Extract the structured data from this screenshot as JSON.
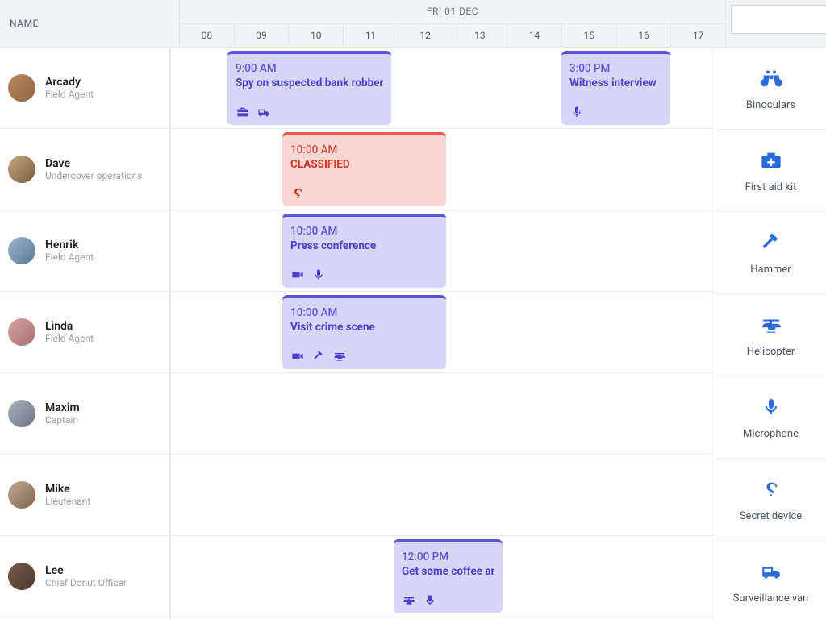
{
  "columns": {
    "name_header": "NAME"
  },
  "date_label": "FRI 01 DEC",
  "hours": [
    "08",
    "09",
    "10",
    "11",
    "12",
    "13",
    "14",
    "15",
    "16",
    "17"
  ],
  "search": {
    "placeholder": ""
  },
  "resources": [
    {
      "name": "Arcady",
      "title": "Field Agent"
    },
    {
      "name": "Dave",
      "title": "Undercover operations"
    },
    {
      "name": "Henrik",
      "title": "Field Agent"
    },
    {
      "name": "Linda",
      "title": "Field Agent"
    },
    {
      "name": "Maxim",
      "title": "Captain"
    },
    {
      "name": "Mike",
      "title": "Lieutenant"
    },
    {
      "name": "Lee",
      "title": "Chief Donut Officer"
    }
  ],
  "events": {
    "arcady_spy": {
      "time": "9:00 AM",
      "title": "Spy on suspected bank robber",
      "icons": [
        "toolbox",
        "van"
      ]
    },
    "arcady_witness": {
      "time": "3:00 PM",
      "title": "Witness interview",
      "icons": [
        "microphone"
      ]
    },
    "dave_classified": {
      "time": "10:00 AM",
      "title": "CLASSIFIED",
      "icons": [
        "secret"
      ]
    },
    "henrik_press": {
      "time": "10:00 AM",
      "title": "Press conference",
      "icons": [
        "camera",
        "microphone"
      ]
    },
    "linda_crime": {
      "time": "10:00 AM",
      "title": "Visit crime scene",
      "icons": [
        "camera",
        "hammer",
        "helicopter"
      ]
    },
    "lee_coffee": {
      "time": "12:00 PM",
      "title": "Get some coffee an",
      "icons": [
        "helicopter",
        "microphone"
      ]
    }
  },
  "equipment": [
    {
      "key": "binoculars",
      "label": "Binoculars"
    },
    {
      "key": "firstaid",
      "label": "First aid kit"
    },
    {
      "key": "hammer",
      "label": "Hammer"
    },
    {
      "key": "helicopter",
      "label": "Helicopter"
    },
    {
      "key": "microphone",
      "label": "Microphone"
    },
    {
      "key": "secret",
      "label": "Secret device"
    },
    {
      "key": "van",
      "label": "Surveillance van"
    }
  ]
}
